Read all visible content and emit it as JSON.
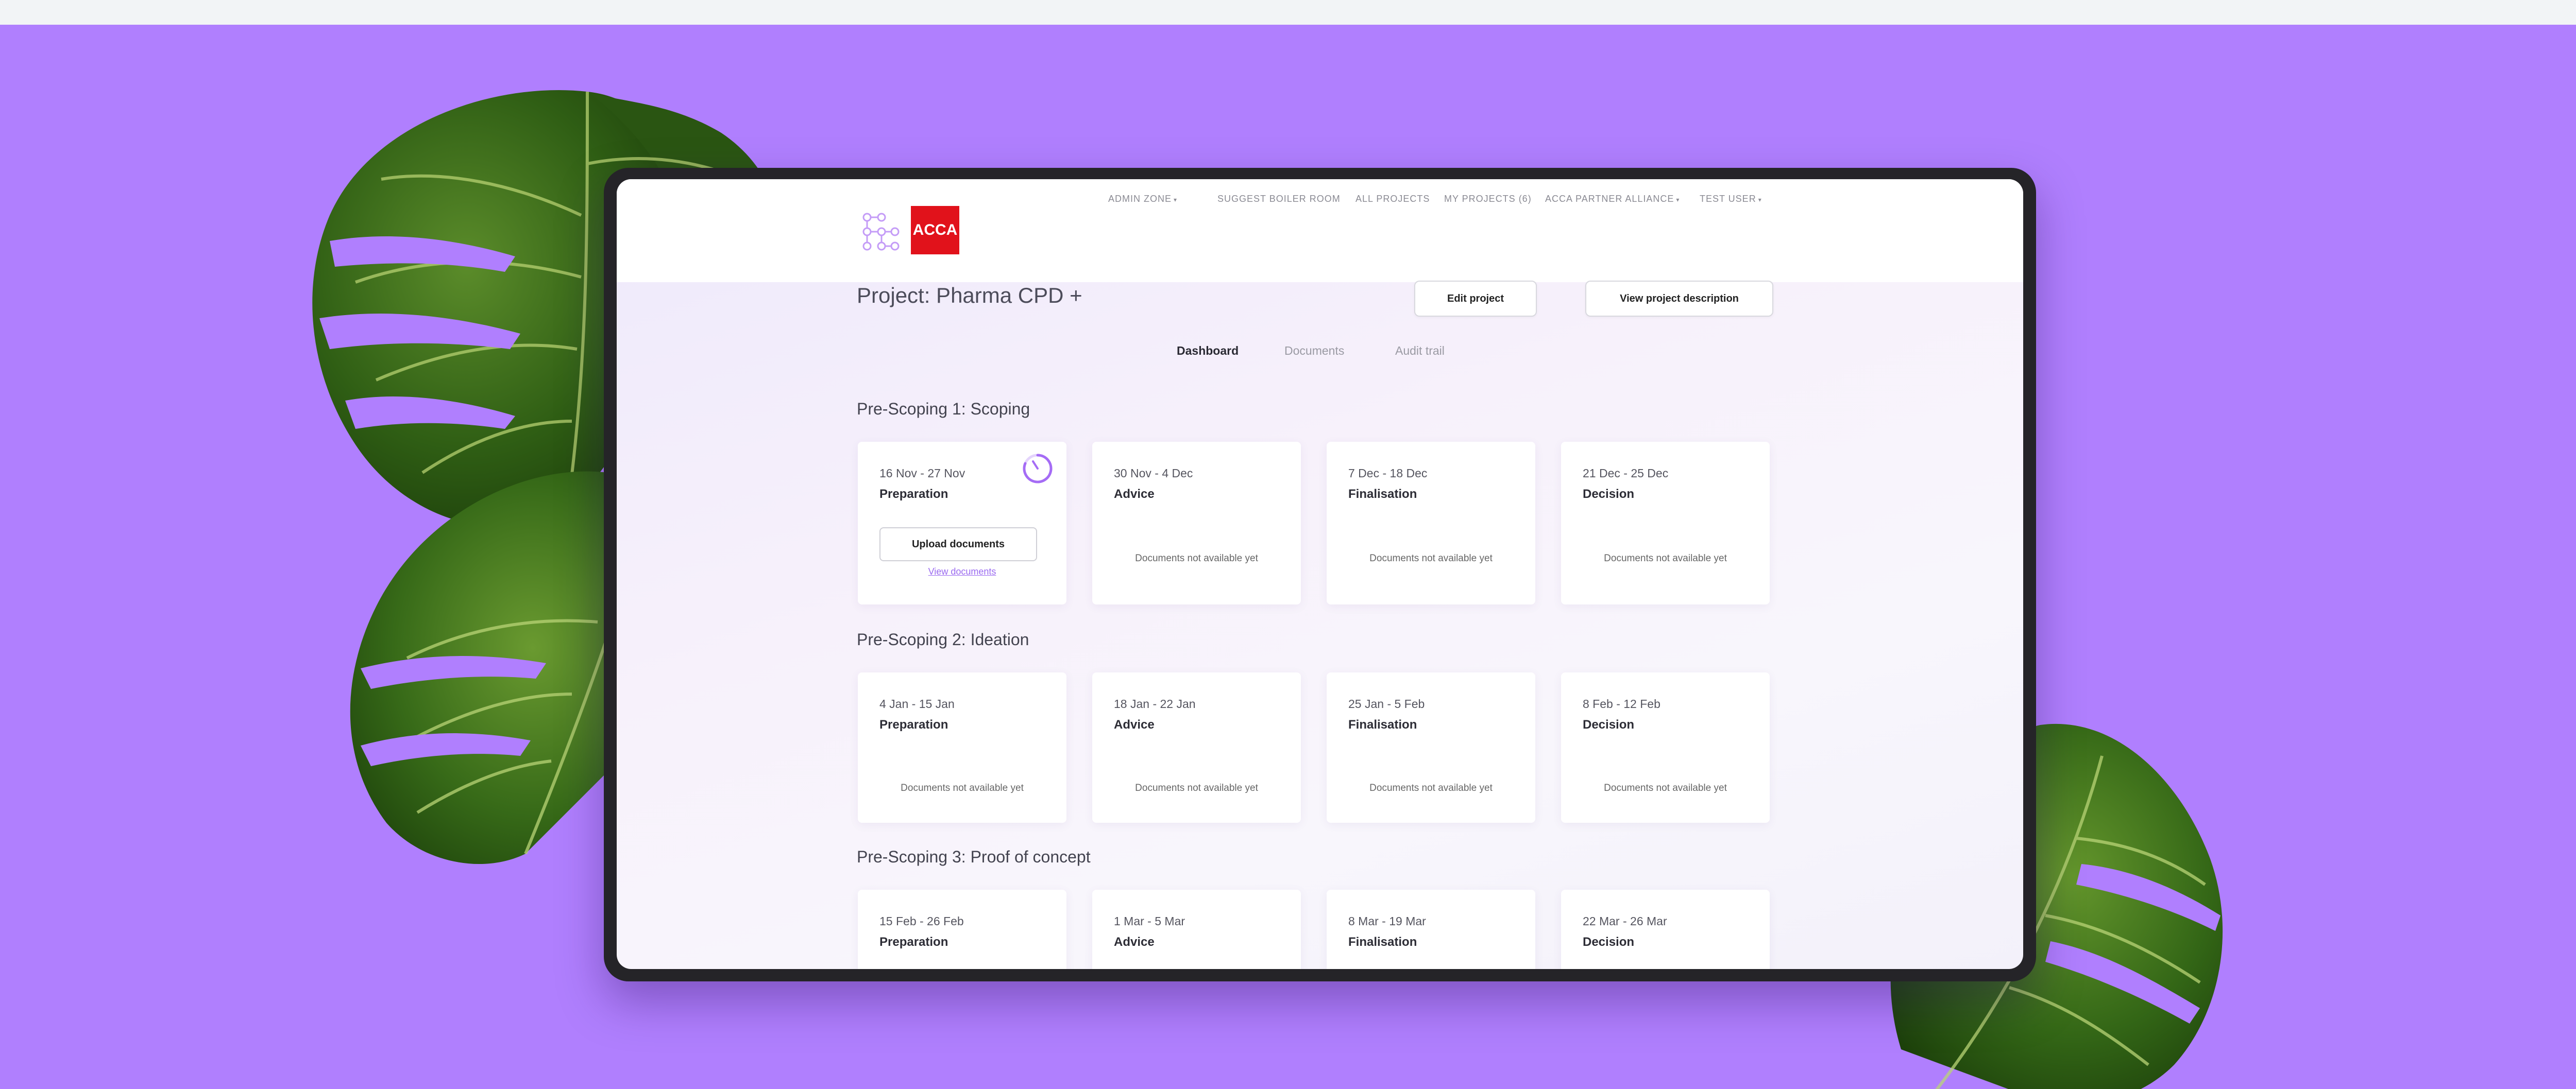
{
  "colors": {
    "background": "#b07ffe",
    "brand": "#e1121b",
    "accent": "#9b6bf0"
  },
  "brand": {
    "logo_text": "ACCA",
    "logo_mark_icon": "network-dots-icon"
  },
  "nav": {
    "items": [
      {
        "label": "ADMIN ZONE",
        "dropdown": true
      },
      {
        "label": "SUGGEST BOILER ROOM",
        "dropdown": false
      },
      {
        "label": "ALL PROJECTS",
        "dropdown": false
      },
      {
        "label": "MY PROJECTS (6)",
        "dropdown": false
      },
      {
        "label": "ACCA PARTNER ALLIANCE",
        "dropdown": true
      },
      {
        "label": "TEST USER",
        "dropdown": true
      }
    ],
    "caret": "▾"
  },
  "project": {
    "title": "Project: Pharma CPD +"
  },
  "actions": {
    "edit": "Edit project",
    "view_description": "View project description"
  },
  "tabs": [
    {
      "label": "Dashboard",
      "active": true
    },
    {
      "label": "Documents",
      "active": false
    },
    {
      "label": "Audit trail",
      "active": false
    }
  ],
  "sections": [
    {
      "title": "Pre-Scoping 1: Scoping",
      "cards": [
        {
          "date": "16 Nov - 27 Nov",
          "phase": "Preparation",
          "upload": "Upload documents",
          "view": "View documents",
          "status_icon": "timer-icon"
        },
        {
          "date": "30 Nov - 4 Dec",
          "phase": "Advice",
          "note": "Documents not available yet"
        },
        {
          "date": "7 Dec - 18 Dec",
          "phase": "Finalisation",
          "note": "Documents not available yet"
        },
        {
          "date": "21 Dec - 25 Dec",
          "phase": "Decision",
          "note": "Documents not available yet"
        }
      ]
    },
    {
      "title": "Pre-Scoping 2: Ideation",
      "cards": [
        {
          "date": "4 Jan - 15 Jan",
          "phase": "Preparation",
          "note": "Documents not available yet"
        },
        {
          "date": "18 Jan - 22 Jan",
          "phase": "Advice",
          "note": "Documents not available yet"
        },
        {
          "date": "25 Jan - 5 Feb",
          "phase": "Finalisation",
          "note": "Documents not available yet"
        },
        {
          "date": "8 Feb - 12 Feb",
          "phase": "Decision",
          "note": "Documents not available yet"
        }
      ]
    },
    {
      "title": "Pre-Scoping 3: Proof of concept",
      "cards": [
        {
          "date": "15 Feb - 26 Feb",
          "phase": "Preparation"
        },
        {
          "date": "1 Mar - 5 Mar",
          "phase": "Advice"
        },
        {
          "date": "8 Mar - 19 Mar",
          "phase": "Finalisation"
        },
        {
          "date": "22 Mar - 26 Mar",
          "phase": "Decision"
        }
      ]
    }
  ]
}
